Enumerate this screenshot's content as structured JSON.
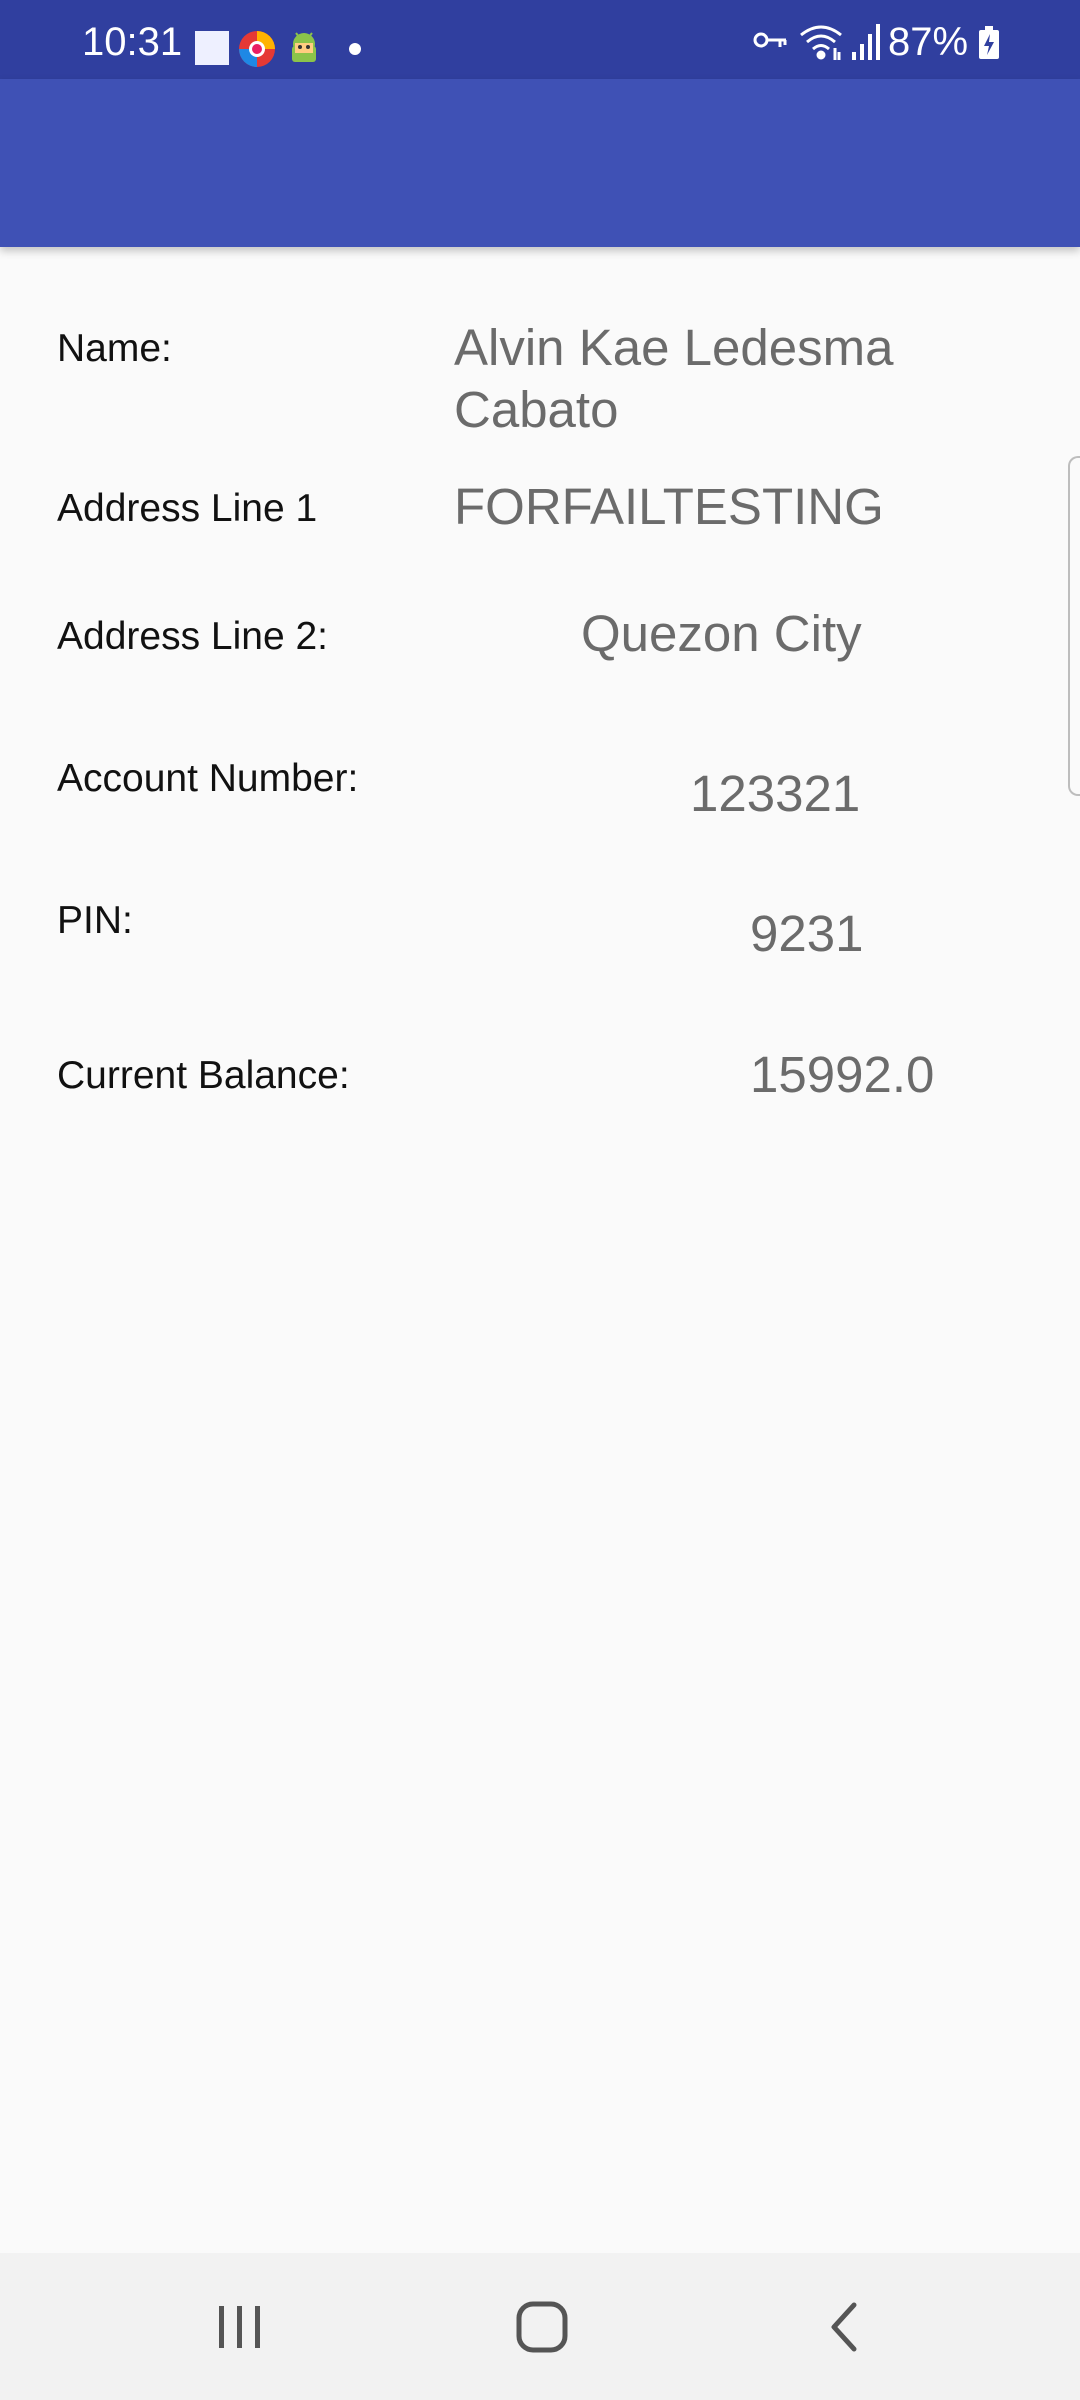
{
  "status_bar": {
    "time": "10:31",
    "battery": "87%",
    "notification_icons": [
      "white-square-icon",
      "browser-icon",
      "android-icon",
      "dot-icon"
    ],
    "system_icons": [
      "vpn-key-icon",
      "wifi-icon",
      "signal-icon",
      "battery-charging-icon"
    ]
  },
  "colors": {
    "status_bar": "#303f9f",
    "app_bar": "#3f51b5",
    "background": "#fafafa",
    "label_text": "#111111",
    "value_text": "#6b6b6b"
  },
  "fields": {
    "name": {
      "label": "Name:",
      "value_line1": "Alvin Kae Ledesma",
      "value_line2": "Cabato"
    },
    "address1": {
      "label": "Address Line 1",
      "value": "FORFAILTESTING"
    },
    "address2": {
      "label": "Address Line 2:",
      "value": "Quezon City"
    },
    "account_number": {
      "label": "Account Number:",
      "value": "123321"
    },
    "pin": {
      "label": "PIN:",
      "value": "9231"
    },
    "current_balance": {
      "label": "Current Balance:",
      "value": "15992.0"
    }
  },
  "nav_bar": {
    "recents": "recents-icon",
    "home": "home-icon",
    "back": "back-icon"
  }
}
